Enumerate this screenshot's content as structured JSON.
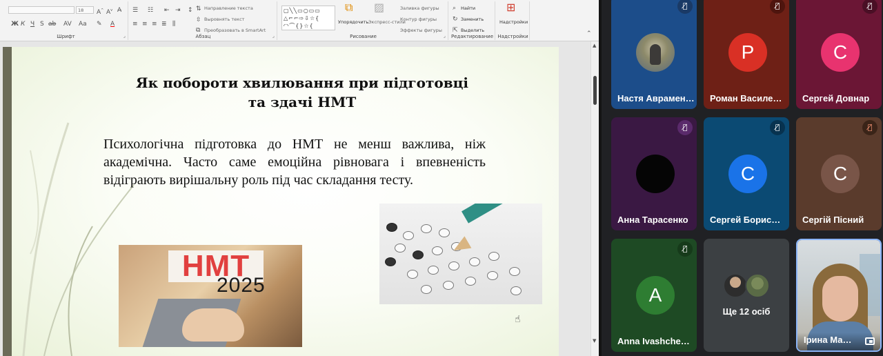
{
  "ribbon": {
    "groups": [
      {
        "id": "font",
        "label": "Шрифт"
      },
      {
        "id": "paragraph",
        "label": "Абзац"
      },
      {
        "id": "drawing",
        "label": "Рисование"
      },
      {
        "id": "editing",
        "label": "Редактирование"
      },
      {
        "id": "addins",
        "label": "Надстройки"
      }
    ],
    "font": {
      "size_value": "18"
    },
    "paragraph": {
      "text_direction": "Направление текста",
      "align_text": "Выровнять текст",
      "convert_smartart": "Преобразовать в SmartArt"
    },
    "drawing": {
      "arrange": "Упорядочить",
      "quick_styles": "Экспресс-стили",
      "shape_fill": "Заливка фигуры",
      "shape_outline": "Контур фигуры",
      "shape_effects": "Эффекты фигуры"
    },
    "editing": {
      "find": "Найти",
      "replace": "Заменить",
      "select": "Выделить"
    },
    "addins": {
      "addins_button": "Надстройки"
    }
  },
  "slide": {
    "title_line1": "Як побороти хвилювання при підготовці",
    "title_line2": "та здачі НМТ",
    "body": "Психологічна підготовка до НМТ не менш важлива, ніж академічна. Часто саме емоційна рівновага і впевненість відіграють вирішальну роль під час складання тесту.",
    "image_nmt": {
      "word": "НМТ",
      "year": "2025"
    }
  },
  "meeting": {
    "colors": {
      "red": "#d93025",
      "pink": "#e8336f",
      "blue": "#1a73e8",
      "brown": "#795548",
      "green": "#2e7d32",
      "purple": "#5a2a6b"
    },
    "participants": [
      {
        "name": "Настя Аврамен…",
        "initial": "",
        "muted": true,
        "avatar": "photo"
      },
      {
        "name": "Роман Василе…",
        "initial": "Р",
        "muted": true
      },
      {
        "name": "Сергей Довнар",
        "initial": "С",
        "muted": true
      },
      {
        "name": "Анна Тарасенко",
        "initial": "",
        "muted": true,
        "avatar": "black"
      },
      {
        "name": "Сергей Борис…",
        "initial": "С",
        "muted": true
      },
      {
        "name": "Сергій Пісний",
        "initial": "С",
        "muted": true
      },
      {
        "name": "Anna Ivashche…",
        "initial": "A",
        "muted": true
      },
      {
        "name": "Ірина Ма…",
        "initial": "",
        "muted": false,
        "avatar": "video"
      }
    ],
    "others": {
      "label": "Ще 12 осіб"
    }
  }
}
